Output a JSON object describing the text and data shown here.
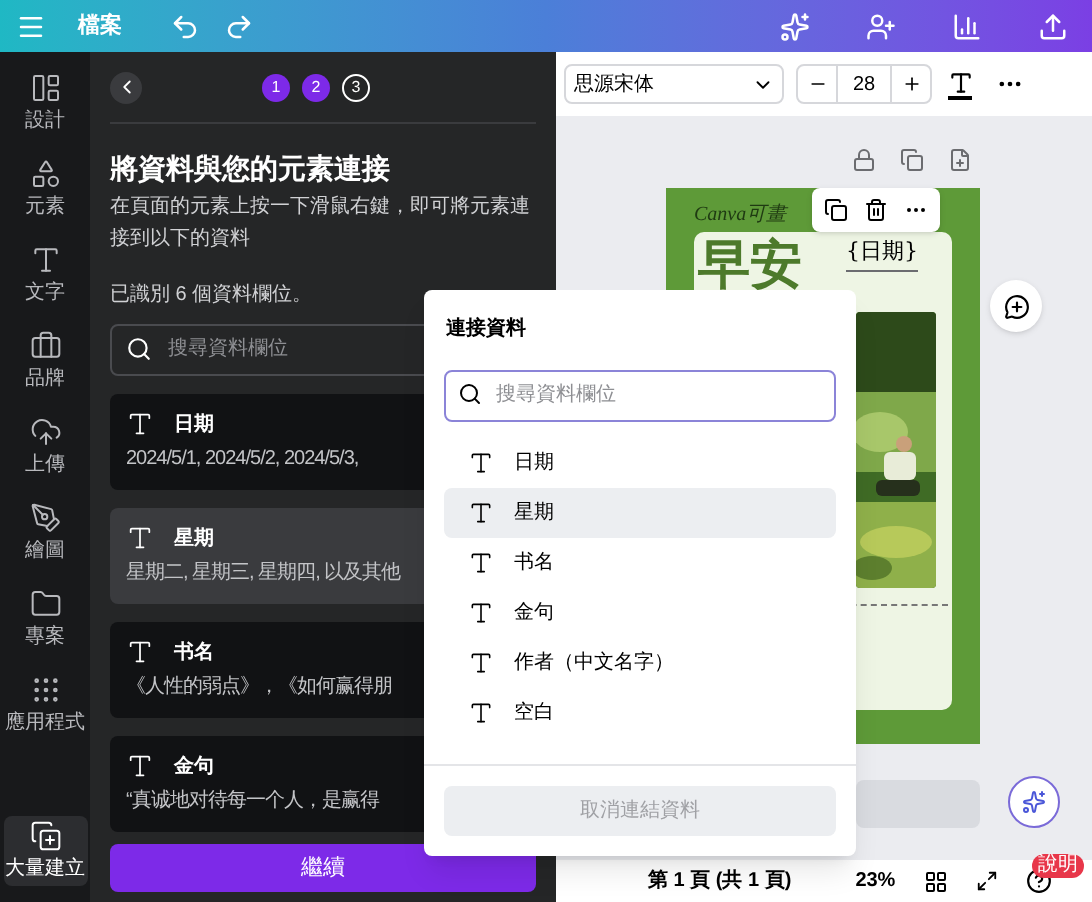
{
  "topbar": {
    "file_menu": "檔案"
  },
  "rail": [
    {
      "label": "設計",
      "kind": "layout",
      "selected": false
    },
    {
      "label": "元素",
      "kind": "shapes",
      "selected": false
    },
    {
      "label": "文字",
      "kind": "text",
      "selected": false
    },
    {
      "label": "品牌",
      "kind": "brand",
      "selected": false
    },
    {
      "label": "上傳",
      "kind": "upload",
      "selected": false
    },
    {
      "label": "繪圖",
      "kind": "draw",
      "selected": false
    },
    {
      "label": "專案",
      "kind": "folder",
      "selected": false
    },
    {
      "label": "應用程式",
      "kind": "apps",
      "selected": false
    },
    {
      "label": "大量建立",
      "kind": "bulk",
      "selected": true
    }
  ],
  "panel": {
    "steps": [
      {
        "label": "1",
        "completed": true
      },
      {
        "label": "2",
        "completed": true
      },
      {
        "label": "3",
        "completed": false
      }
    ],
    "title": "將資料與您的元素連接",
    "description": "在頁面的元素上按一下滑鼠右鍵，即可將元素連接到以下的資料",
    "detected": "已識別 6 個資料欄位。",
    "search": {
      "placeholder": "搜尋資料欄位"
    },
    "fields": [
      {
        "name": "日期",
        "preview": "2024/5/1, 2024/5/2, 2024/5/3,",
        "selected": false
      },
      {
        "name": "星期",
        "preview": "星期二, 星期三, 星期四, 以及其他",
        "selected": true
      },
      {
        "name": "书名",
        "preview": "《人性的弱点》，《如何赢得朋",
        "selected": false
      },
      {
        "name": "金句",
        "preview": "“真诚地对待每一个人，是赢得",
        "selected": false
      }
    ],
    "continue_button": "繼續"
  },
  "toolbar": {
    "font": "思源宋体",
    "size": "28"
  },
  "design": {
    "logo": "Canva可畫",
    "greeting": "早安",
    "date_field": "{日期}"
  },
  "popup": {
    "title": "連接資料",
    "search": {
      "placeholder": "搜尋資料欄位"
    },
    "items": [
      {
        "label": "日期",
        "selected": false
      },
      {
        "label": "星期",
        "selected": true
      },
      {
        "label": "书名",
        "selected": false
      },
      {
        "label": "金句",
        "selected": false
      },
      {
        "label": "作者（中文名字）",
        "selected": false
      },
      {
        "label": "空白",
        "selected": false
      }
    ],
    "unlink_button": "取消連結資料"
  },
  "status_bar": {
    "page": "第 1 頁 (共 1 頁)",
    "zoom": "23%",
    "help_badge": "說明"
  }
}
